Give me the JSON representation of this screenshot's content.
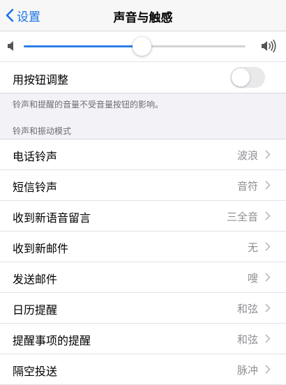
{
  "nav": {
    "back_label": "设置",
    "title": "声音与触感",
    "back_icon": "chevron-left-icon"
  },
  "volume": {
    "level": 0.53,
    "low_icon": "speaker-low-icon",
    "high_icon": "speaker-high-icon"
  },
  "change_with_buttons": {
    "label": "用按钮调整",
    "enabled": false,
    "footnote": "铃声和提醒的音量不受音量按钮的影响。"
  },
  "section": {
    "header": "铃声和振动模式",
    "items": [
      {
        "label": "电话铃声",
        "value": "波浪"
      },
      {
        "label": "短信铃声",
        "value": "音符"
      },
      {
        "label": "收到新语音留言",
        "value": "三全音"
      },
      {
        "label": "收到新邮件",
        "value": "无"
      },
      {
        "label": "发送邮件",
        "value": "嗖"
      },
      {
        "label": "日历提醒",
        "value": "和弦"
      },
      {
        "label": "提醒事项的提醒",
        "value": "和弦"
      },
      {
        "label": "隔空投送",
        "value": "脉冲"
      }
    ]
  },
  "colors": {
    "accent": "#1a73e8",
    "background": "#f2f2f7",
    "secondary_text": "#8e8e93"
  }
}
